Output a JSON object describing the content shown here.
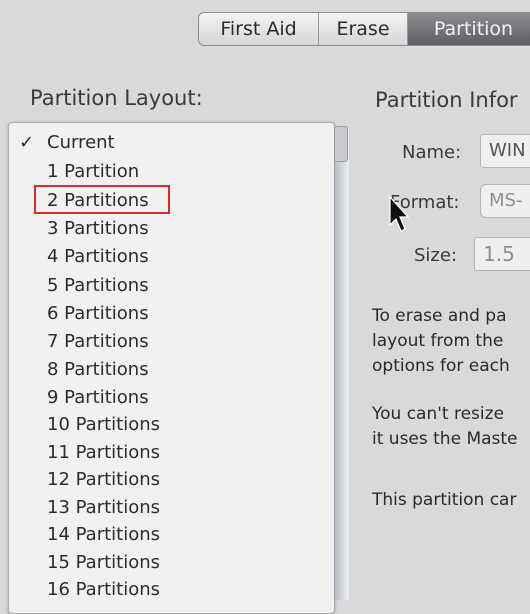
{
  "tabs": [
    {
      "label": "First Aid"
    },
    {
      "label": "Erase"
    },
    {
      "label": "Partition"
    }
  ],
  "layout_panel": {
    "title": "Partition Layout:",
    "items": [
      {
        "check": "✓",
        "label": "Current"
      },
      {
        "check": "",
        "label": "1 Partition"
      },
      {
        "check": "",
        "label": "2 Partitions"
      },
      {
        "check": "",
        "label": "3 Partitions"
      },
      {
        "check": "",
        "label": "4 Partitions"
      },
      {
        "check": "",
        "label": "5 Partitions"
      },
      {
        "check": "",
        "label": "6 Partitions"
      },
      {
        "check": "",
        "label": "7 Partitions"
      },
      {
        "check": "",
        "label": "8 Partitions"
      },
      {
        "check": "",
        "label": "9 Partitions"
      },
      {
        "check": "",
        "label": "10 Partitions"
      },
      {
        "check": "",
        "label": "11 Partitions"
      },
      {
        "check": "",
        "label": "12 Partitions"
      },
      {
        "check": "",
        "label": "13 Partitions"
      },
      {
        "check": "",
        "label": "14 Partitions"
      },
      {
        "check": "",
        "label": "15 Partitions"
      },
      {
        "check": "",
        "label": "16 Partitions"
      }
    ],
    "highlight_color": "#e0282a"
  },
  "info_panel": {
    "title": "Partition Infor",
    "name_label": "Name:",
    "name_value": "WIN",
    "format_label": "Format:",
    "format_value": "MS-",
    "size_label": "Size:",
    "size_value": "1.5",
    "paragraph1": [
      "To erase and pa",
      "layout from the",
      "options for each"
    ],
    "paragraph2": [
      "You can't resize",
      "it uses the Maste"
    ],
    "paragraph3": "This partition car"
  },
  "cursor_icon": "arrow-pointer-icon"
}
